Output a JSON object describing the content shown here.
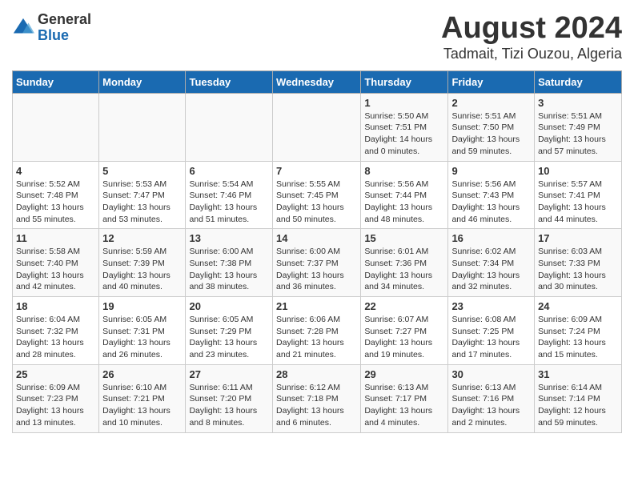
{
  "logo": {
    "general": "General",
    "blue": "Blue"
  },
  "title": "August 2024",
  "subtitle": "Tadmait, Tizi Ouzou, Algeria",
  "headers": [
    "Sunday",
    "Monday",
    "Tuesday",
    "Wednesday",
    "Thursday",
    "Friday",
    "Saturday"
  ],
  "weeks": [
    [
      {
        "day": "",
        "info": ""
      },
      {
        "day": "",
        "info": ""
      },
      {
        "day": "",
        "info": ""
      },
      {
        "day": "",
        "info": ""
      },
      {
        "day": "1",
        "info": "Sunrise: 5:50 AM\nSunset: 7:51 PM\nDaylight: 14 hours\nand 0 minutes."
      },
      {
        "day": "2",
        "info": "Sunrise: 5:51 AM\nSunset: 7:50 PM\nDaylight: 13 hours\nand 59 minutes."
      },
      {
        "day": "3",
        "info": "Sunrise: 5:51 AM\nSunset: 7:49 PM\nDaylight: 13 hours\nand 57 minutes."
      }
    ],
    [
      {
        "day": "4",
        "info": "Sunrise: 5:52 AM\nSunset: 7:48 PM\nDaylight: 13 hours\nand 55 minutes."
      },
      {
        "day": "5",
        "info": "Sunrise: 5:53 AM\nSunset: 7:47 PM\nDaylight: 13 hours\nand 53 minutes."
      },
      {
        "day": "6",
        "info": "Sunrise: 5:54 AM\nSunset: 7:46 PM\nDaylight: 13 hours\nand 51 minutes."
      },
      {
        "day": "7",
        "info": "Sunrise: 5:55 AM\nSunset: 7:45 PM\nDaylight: 13 hours\nand 50 minutes."
      },
      {
        "day": "8",
        "info": "Sunrise: 5:56 AM\nSunset: 7:44 PM\nDaylight: 13 hours\nand 48 minutes."
      },
      {
        "day": "9",
        "info": "Sunrise: 5:56 AM\nSunset: 7:43 PM\nDaylight: 13 hours\nand 46 minutes."
      },
      {
        "day": "10",
        "info": "Sunrise: 5:57 AM\nSunset: 7:41 PM\nDaylight: 13 hours\nand 44 minutes."
      }
    ],
    [
      {
        "day": "11",
        "info": "Sunrise: 5:58 AM\nSunset: 7:40 PM\nDaylight: 13 hours\nand 42 minutes."
      },
      {
        "day": "12",
        "info": "Sunrise: 5:59 AM\nSunset: 7:39 PM\nDaylight: 13 hours\nand 40 minutes."
      },
      {
        "day": "13",
        "info": "Sunrise: 6:00 AM\nSunset: 7:38 PM\nDaylight: 13 hours\nand 38 minutes."
      },
      {
        "day": "14",
        "info": "Sunrise: 6:00 AM\nSunset: 7:37 PM\nDaylight: 13 hours\nand 36 minutes."
      },
      {
        "day": "15",
        "info": "Sunrise: 6:01 AM\nSunset: 7:36 PM\nDaylight: 13 hours\nand 34 minutes."
      },
      {
        "day": "16",
        "info": "Sunrise: 6:02 AM\nSunset: 7:34 PM\nDaylight: 13 hours\nand 32 minutes."
      },
      {
        "day": "17",
        "info": "Sunrise: 6:03 AM\nSunset: 7:33 PM\nDaylight: 13 hours\nand 30 minutes."
      }
    ],
    [
      {
        "day": "18",
        "info": "Sunrise: 6:04 AM\nSunset: 7:32 PM\nDaylight: 13 hours\nand 28 minutes."
      },
      {
        "day": "19",
        "info": "Sunrise: 6:05 AM\nSunset: 7:31 PM\nDaylight: 13 hours\nand 26 minutes."
      },
      {
        "day": "20",
        "info": "Sunrise: 6:05 AM\nSunset: 7:29 PM\nDaylight: 13 hours\nand 23 minutes."
      },
      {
        "day": "21",
        "info": "Sunrise: 6:06 AM\nSunset: 7:28 PM\nDaylight: 13 hours\nand 21 minutes."
      },
      {
        "day": "22",
        "info": "Sunrise: 6:07 AM\nSunset: 7:27 PM\nDaylight: 13 hours\nand 19 minutes."
      },
      {
        "day": "23",
        "info": "Sunrise: 6:08 AM\nSunset: 7:25 PM\nDaylight: 13 hours\nand 17 minutes."
      },
      {
        "day": "24",
        "info": "Sunrise: 6:09 AM\nSunset: 7:24 PM\nDaylight: 13 hours\nand 15 minutes."
      }
    ],
    [
      {
        "day": "25",
        "info": "Sunrise: 6:09 AM\nSunset: 7:23 PM\nDaylight: 13 hours\nand 13 minutes."
      },
      {
        "day": "26",
        "info": "Sunrise: 6:10 AM\nSunset: 7:21 PM\nDaylight: 13 hours\nand 10 minutes."
      },
      {
        "day": "27",
        "info": "Sunrise: 6:11 AM\nSunset: 7:20 PM\nDaylight: 13 hours\nand 8 minutes."
      },
      {
        "day": "28",
        "info": "Sunrise: 6:12 AM\nSunset: 7:18 PM\nDaylight: 13 hours\nand 6 minutes."
      },
      {
        "day": "29",
        "info": "Sunrise: 6:13 AM\nSunset: 7:17 PM\nDaylight: 13 hours\nand 4 minutes."
      },
      {
        "day": "30",
        "info": "Sunrise: 6:13 AM\nSunset: 7:16 PM\nDaylight: 13 hours\nand 2 minutes."
      },
      {
        "day": "31",
        "info": "Sunrise: 6:14 AM\nSunset: 7:14 PM\nDaylight: 12 hours\nand 59 minutes."
      }
    ]
  ]
}
